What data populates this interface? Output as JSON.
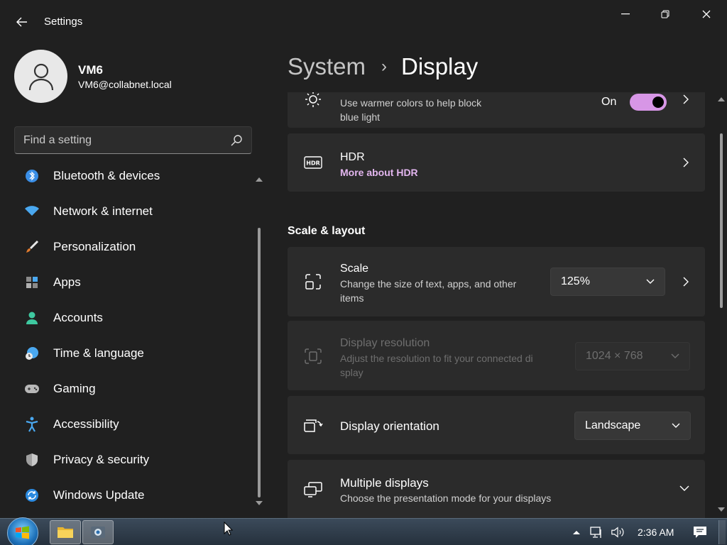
{
  "window": {
    "title": "Settings",
    "back_icon": "back-arrow-icon",
    "controls": [
      "minimize-icon",
      "restore-icon",
      "close-icon"
    ]
  },
  "user": {
    "name": "VM6",
    "email": "VM6@collabnet.local",
    "avatar_icon": "person-icon"
  },
  "search": {
    "placeholder": "Find a setting",
    "icon": "search-icon"
  },
  "nav": {
    "items": [
      {
        "label": "Bluetooth & devices",
        "icon": "bluetooth-icon"
      },
      {
        "label": "Network & internet",
        "icon": "wifi-icon"
      },
      {
        "label": "Personalization",
        "icon": "brush-icon"
      },
      {
        "label": "Apps",
        "icon": "apps-icon"
      },
      {
        "label": "Accounts",
        "icon": "accounts-icon"
      },
      {
        "label": "Time & language",
        "icon": "time-language-icon"
      },
      {
        "label": "Gaming",
        "icon": "gamepad-icon"
      },
      {
        "label": "Accessibility",
        "icon": "accessibility-icon"
      },
      {
        "label": "Privacy & security",
        "icon": "shield-icon"
      },
      {
        "label": "Windows Update",
        "icon": "update-icon"
      }
    ]
  },
  "breadcrumb": {
    "parent": "System",
    "separator": "›",
    "current": "Display"
  },
  "main": {
    "night_light": {
      "subtitle_line1": "Use warmer colors to help block",
      "subtitle_line2": "blue light",
      "toggle_label": "On",
      "toggle_on": true,
      "icon": "brightness-icon"
    },
    "hdr": {
      "title": "HDR",
      "link": "More about HDR",
      "icon": "hdr-icon"
    },
    "section_title": "Scale & layout",
    "scale": {
      "title": "Scale",
      "subtitle_line1": "Change the size of text, apps, and other",
      "subtitle_line2": "items",
      "value": "125%",
      "icon": "scale-icon"
    },
    "resolution": {
      "title": "Display resolution",
      "subtitle_line1": "Adjust the resolution to fit your connected di",
      "subtitle_line2": "splay",
      "value": "1024 × 768",
      "disabled": true,
      "icon": "resolution-icon"
    },
    "orientation": {
      "title": "Display orientation",
      "value": "Landscape",
      "icon": "orientation-icon"
    },
    "multiple_displays": {
      "title": "Multiple displays",
      "subtitle": "Choose the presentation mode for your displays",
      "icon": "multiple-displays-icon"
    }
  },
  "taskbar": {
    "start_icon": "windows-start-icon",
    "pinned": [
      "file-explorer-icon",
      "settings-app-icon"
    ],
    "tray": [
      "show-hidden-icons-icon",
      "network-icon",
      "volume-icon"
    ],
    "time": "2:36 AM",
    "notification_icon": "action-center-icon"
  },
  "colors": {
    "background": "#202020",
    "card": "#2b2b2b",
    "accent": "#d796e6",
    "link": "#e3b6ef"
  }
}
